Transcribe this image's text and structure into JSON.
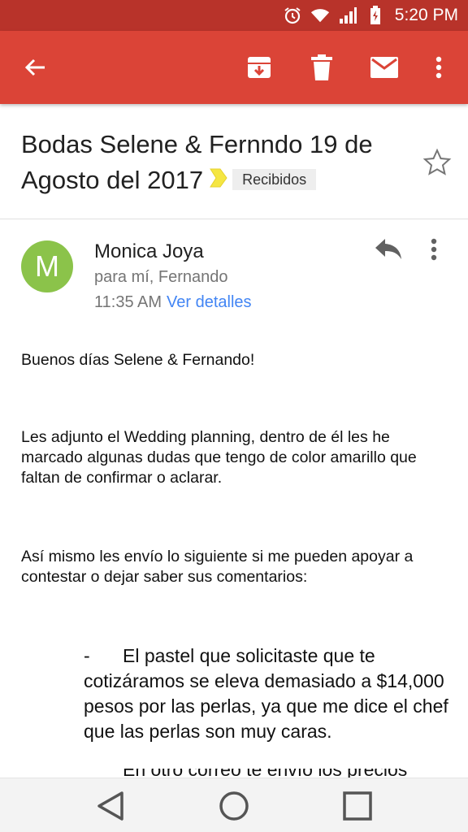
{
  "status_bar": {
    "time": "5:20 PM",
    "icons": [
      "alarm-icon",
      "wifi-icon",
      "signal-icon",
      "battery-icon"
    ]
  },
  "app_bar": {
    "icons": [
      "back-arrow-icon",
      "archive-icon",
      "delete-icon",
      "mark-unread-icon",
      "more-vert-icon"
    ]
  },
  "email": {
    "subject": "Bodas Selene & Fernndo 19 de Agosto del 2017",
    "label": "Recibidos",
    "sender": {
      "initial": "M",
      "name": "Monica Joya",
      "recipients": "para mí, Fernando",
      "time": "11:35 AM",
      "details_link": "Ver detalles"
    },
    "body": {
      "greeting": "Buenos días Selene & Fernando!",
      "paragraph1": "Les adjunto el Wedding planning, dentro de él les he marcado algunas dudas que tengo de color amarillo que faltan de confirmar o aclarar.",
      "paragraph2": "Así mismo les envío lo siguiente si me pueden apoyar a contestar o dejar saber sus comentarios:",
      "bullet_dash": "-",
      "bullet1": "El pastel que solicitaste que te cotizáramos se eleva demasiado a $14,000 pesos por las perlas, ya que me dice el chef que las perlas son muy caras.",
      "bullet2_partial": "En otro correo te envío los precios"
    }
  },
  "colors": {
    "app_bar": "#db4437",
    "status_bar": "#b8332a",
    "avatar": "#8bc34a",
    "link": "#4285f4",
    "importance_marker": "#f5e642"
  },
  "nav_bar": {
    "icons": [
      "back-triangle-icon",
      "home-circle-icon",
      "recents-square-icon"
    ]
  }
}
